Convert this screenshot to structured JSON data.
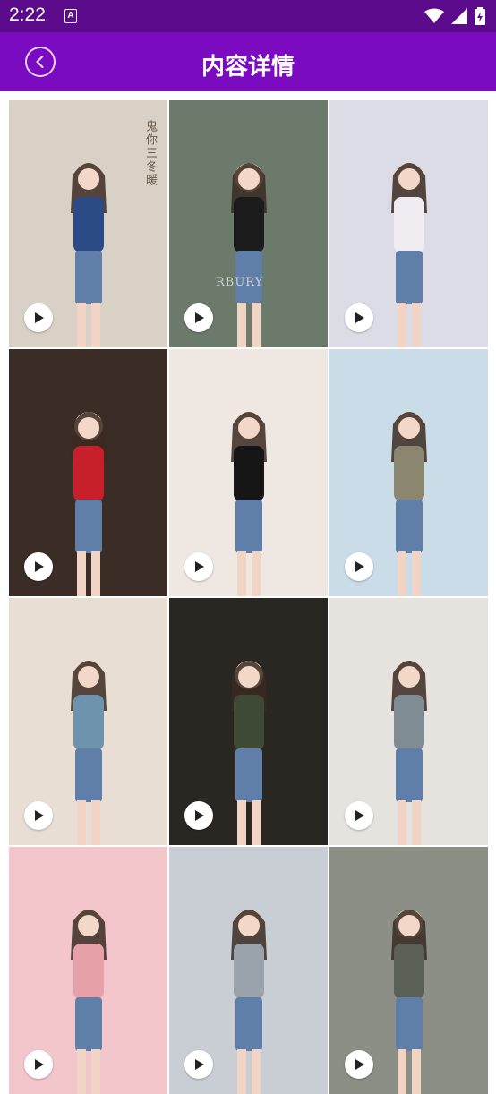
{
  "status_bar": {
    "time": "2:22",
    "notification_glyph": "A",
    "icons": [
      "wifi-icon",
      "signal-icon",
      "battery-icon"
    ]
  },
  "app_bar": {
    "title": "内容详情",
    "back_icon": "chevron-left-circle-icon",
    "background": "#7a0bc0"
  },
  "grid": {
    "tiles": [
      {
        "kind": "video-thumbnail",
        "caption": "鬼你三冬暖",
        "bg": "#d9d0c6",
        "accent": "#2b4a86"
      },
      {
        "kind": "video-thumbnail",
        "caption": "",
        "print": "RBURY",
        "bg": "#6b7a6a",
        "accent": "#1c1c1c"
      },
      {
        "kind": "video-thumbnail",
        "caption": "",
        "bg": "#dcdce6",
        "accent": "#f1ecf2"
      },
      {
        "kind": "video-thumbnail",
        "caption": "",
        "bg": "#3c2c26",
        "accent": "#c8202a"
      },
      {
        "kind": "video-thumbnail",
        "caption": "",
        "bg": "#efe7e1",
        "accent": "#161616"
      },
      {
        "kind": "video-thumbnail",
        "caption": "",
        "bg": "#c9dce8",
        "accent": "#8a8670"
      },
      {
        "kind": "video-thumbnail",
        "caption": "",
        "bg": "#e8ded4",
        "accent": "#6d93ad"
      },
      {
        "kind": "video-thumbnail",
        "caption": "",
        "bg": "#2a2622",
        "accent": "#3f4a36"
      },
      {
        "kind": "video-thumbnail",
        "caption": "",
        "bg": "#e6e2de",
        "accent": "#7f8c94"
      },
      {
        "kind": "video-thumbnail",
        "caption": "",
        "bg": "#f3c6cc",
        "accent": "#e5a0a8"
      },
      {
        "kind": "video-thumbnail",
        "caption": "",
        "bg": "#c9ced4",
        "accent": "#9aa3ab"
      },
      {
        "kind": "video-thumbnail",
        "caption": "",
        "bg": "#8c8f86",
        "accent": "#5b6157"
      }
    ],
    "play_icon": "play-icon"
  }
}
